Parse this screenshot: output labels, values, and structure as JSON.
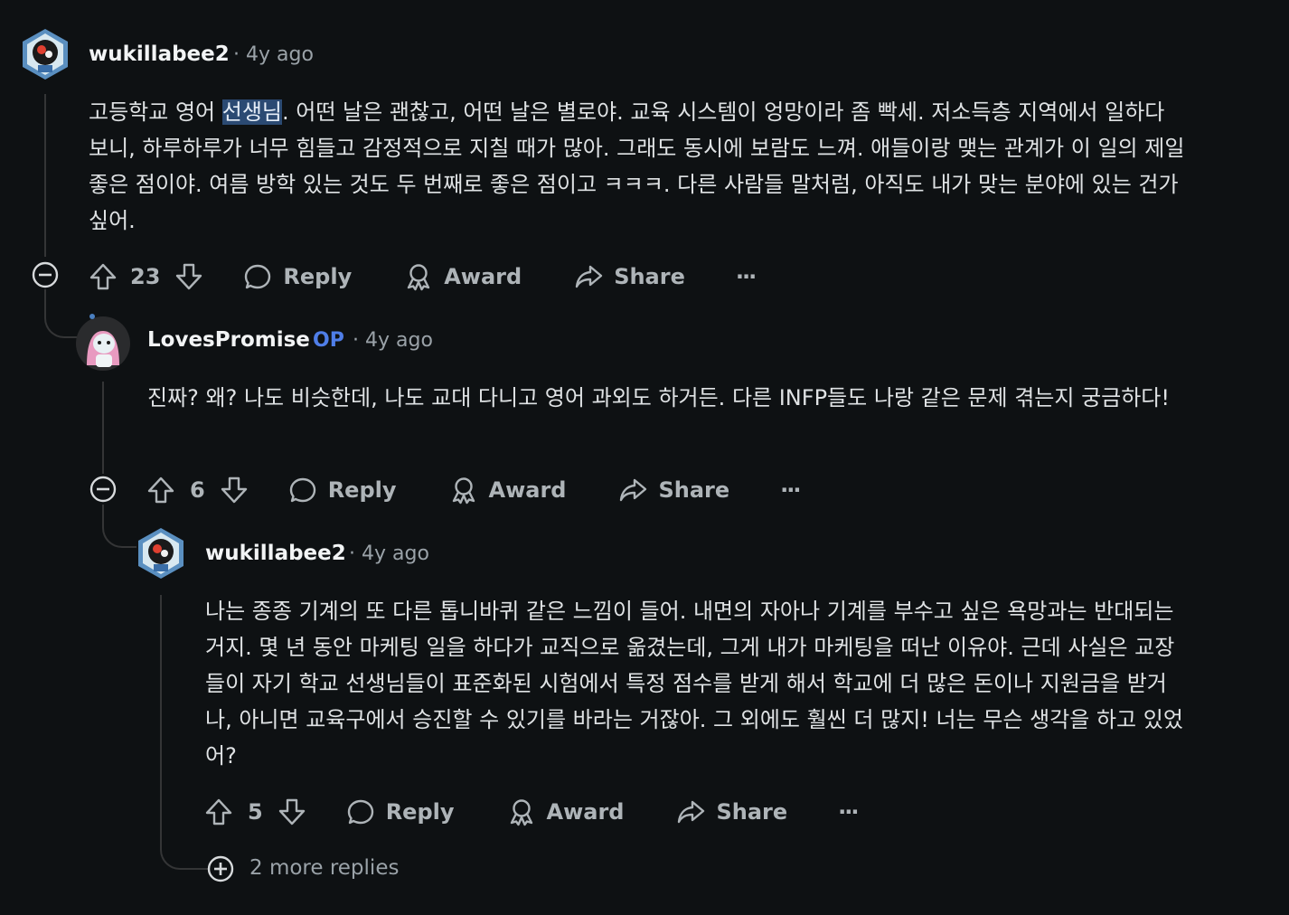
{
  "comments": [
    {
      "username": "wukillabee2",
      "age": "4y ago",
      "body": "고등학교 영어 선생님. 어떤 날은 괜찮고, 어떤 날은 별로야. 교육 시스템이 엉망이라 좀 빡세. 저소득층 지역에서 일하다 보니, 하루하루가 너무 힘들고 감정적으로 지칠 때가 많아. 그래도 동시에 보람도 느껴. 애들이랑 맺는 관계가 이 일의 제일 좋은 점이야. 여름 방학 있는 것도 두 번째로 좋은 점이고 ㅋㅋㅋ. 다른 사람들 말처럼, 아직도 내가 맞는 분야에 있는 건가 싶어.",
      "body_before": "고등학교 영어 ",
      "highlight": "선생님",
      "body_after": ". 어떤 날은 괜찮고, 어떤 날은 별로야. 교육 시스템이 엉망이라 좀 빡세. 저소득층 지역에서 일하다 보니, 하루하루가 너무 힘들고 감정적으로 지칠 때가 많아. 그래도 동시에 보람도 느껴. 애들이랑 맺는 관계가 이 일의 제일 좋은 점이야. 여름 방학 있는 것도 두 번째로 좋은 점이고 ㅋㅋㅋ. 다른 사람들 말처럼, 아직도 내가 맞는 분야에 있는 건가 싶어.",
      "votes": "23",
      "reply": "Reply",
      "award": "Award",
      "share": "Share",
      "more": "···"
    },
    {
      "username": "LovesPromise",
      "flair": "OP",
      "age": "4y ago",
      "body": "진짜? 왜? 나도 비슷한데, 나도 교대 다니고 영어 과외도 하거든. 다른 INFP들도 나랑 같은 문제 겪는지 궁금하다!",
      "votes": "6",
      "reply": "Reply",
      "award": "Award",
      "share": "Share",
      "more": "···"
    },
    {
      "username": "wukillabee2",
      "age": "4y ago",
      "body": "나는 종종 기계의 또 다른 톱니바퀴 같은 느낌이 들어. 내면의 자아나 기계를 부수고 싶은 욕망과는 반대되는 거지. 몇 년 동안 마케팅 일을 하다가 교직으로 옮겼는데, 그게 내가 마케팅을 떠난 이유야. 근데 사실은 교장들이 자기 학교 선생님들이 표준화된 시험에서 특정 점수를 받게 해서 학교에 더 많은 돈이나 지원금을 받거나, 아니면 교육구에서 승진할 수 있기를 바라는 거잖아. 그 외에도 훨씬 더 많지! 너는 무슨 생각을 하고 있었어?",
      "votes": "5",
      "reply": "Reply",
      "award": "Award",
      "share": "Share",
      "more": "···"
    }
  ],
  "more_replies": "2 more replies",
  "colors": {
    "background": "#0e1113",
    "op_flair": "#4f7ee8",
    "highlight": "#2b4a73"
  },
  "icons": [
    "upvote-icon",
    "downvote-icon",
    "reply-bubble-icon",
    "award-icon",
    "share-icon",
    "collapse-icon",
    "expand-icon"
  ]
}
